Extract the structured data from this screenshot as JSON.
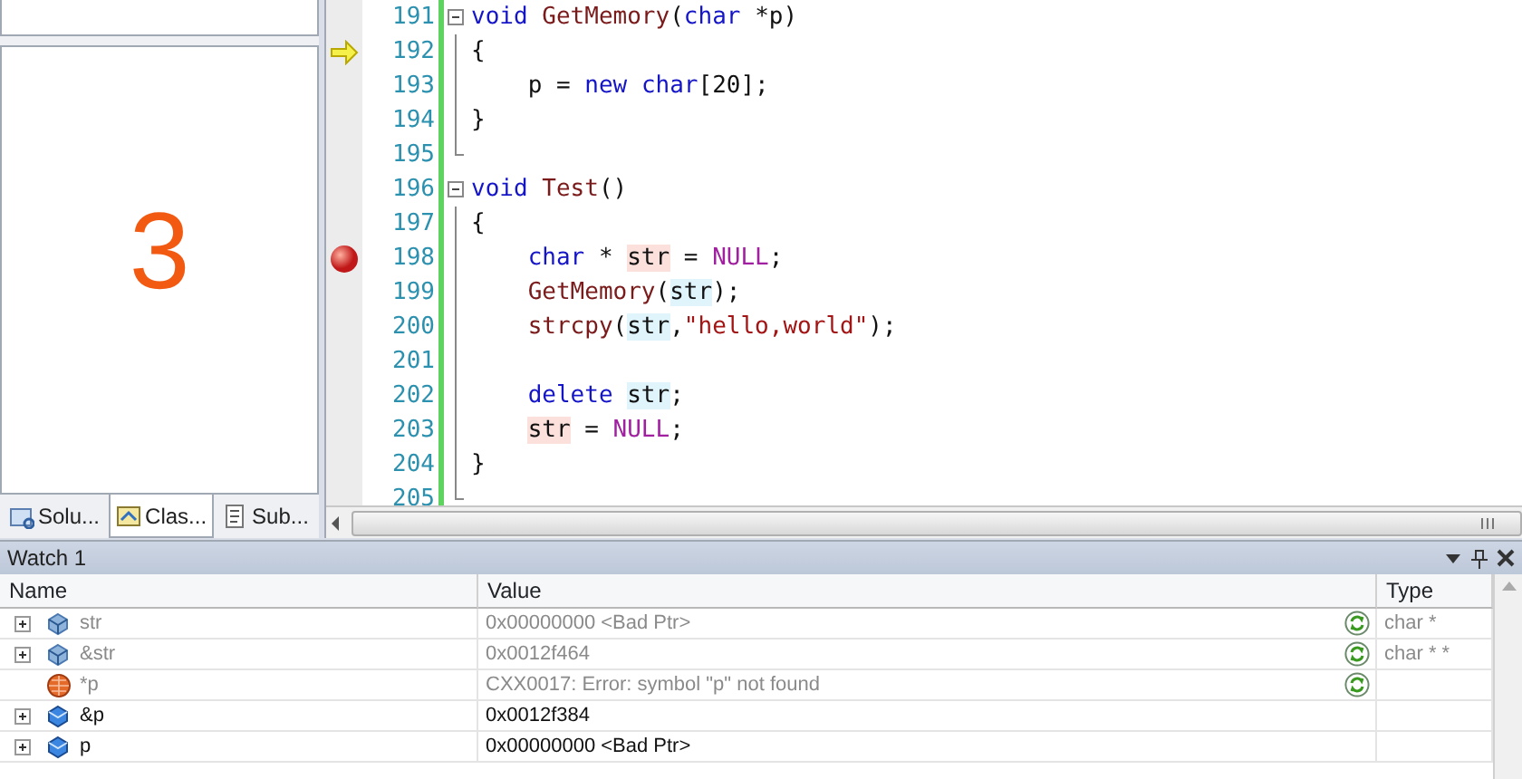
{
  "side_panel": {
    "big_label": "3",
    "tabs": [
      {
        "label": "Solu...",
        "selected": false
      },
      {
        "label": "Clas...",
        "selected": true
      },
      {
        "label": "Sub...",
        "selected": false
      }
    ]
  },
  "editor": {
    "lines": [
      {
        "number": "191",
        "fold_start": true,
        "fold_end": false,
        "current": false,
        "breakpoint": false,
        "tokens": [
          {
            "text": "void",
            "kind": "kw"
          },
          {
            "text": " GetMemory",
            "kind": "fn"
          },
          {
            "text": "(",
            "kind": "plain"
          },
          {
            "text": "char",
            "kind": "kw"
          },
          {
            "text": " *p)",
            "kind": "plain"
          }
        ]
      },
      {
        "number": "192",
        "fold_start": false,
        "fold_end": false,
        "current": true,
        "breakpoint": false,
        "tokens": [
          {
            "text": "{",
            "kind": "plain"
          }
        ]
      },
      {
        "number": "193",
        "fold_start": false,
        "fold_end": false,
        "current": false,
        "breakpoint": false,
        "tokens": [
          {
            "text": "    p = ",
            "kind": "plain"
          },
          {
            "text": "new",
            "kind": "kw"
          },
          {
            "text": " char",
            "kind": "kw"
          },
          {
            "text": "[20];",
            "kind": "plain"
          }
        ]
      },
      {
        "number": "194",
        "fold_start": false,
        "fold_end": false,
        "current": false,
        "breakpoint": false,
        "tokens": [
          {
            "text": "}",
            "kind": "plain"
          }
        ]
      },
      {
        "number": "195",
        "fold_start": false,
        "fold_end": true,
        "current": false,
        "breakpoint": false
      },
      {
        "number": "196",
        "fold_start": true,
        "fold_end": false,
        "current": false,
        "breakpoint": false,
        "tokens": [
          {
            "text": "void",
            "kind": "kw"
          },
          {
            "text": " Test",
            "kind": "fn"
          },
          {
            "text": "()",
            "kind": "plain"
          }
        ]
      },
      {
        "number": "197",
        "fold_start": false,
        "fold_end": false,
        "current": false,
        "breakpoint": false,
        "tokens": [
          {
            "text": "{",
            "kind": "plain"
          }
        ]
      },
      {
        "number": "198",
        "fold_start": false,
        "fold_end": false,
        "current": false,
        "breakpoint": true,
        "tokens": [
          {
            "text": "    char",
            "kind": "kw"
          },
          {
            "text": " * ",
            "kind": "plain"
          },
          {
            "text": "str",
            "kind": "write"
          },
          {
            "text": " = ",
            "kind": "plain"
          },
          {
            "text": "NULL",
            "kind": "macro"
          },
          {
            "text": ";",
            "kind": "plain"
          }
        ]
      },
      {
        "number": "199",
        "fold_start": false,
        "fold_end": false,
        "current": false,
        "breakpoint": false,
        "tokens": [
          {
            "text": "    GetMemory",
            "kind": "fn"
          },
          {
            "text": "(",
            "kind": "plain"
          },
          {
            "text": "str",
            "kind": "read"
          },
          {
            "text": ");",
            "kind": "plain"
          }
        ]
      },
      {
        "number": "200",
        "fold_start": false,
        "fold_end": false,
        "current": false,
        "breakpoint": false,
        "tokens": [
          {
            "text": "    strcpy",
            "kind": "fn"
          },
          {
            "text": "(",
            "kind": "plain"
          },
          {
            "text": "str",
            "kind": "read"
          },
          {
            "text": ",",
            "kind": "plain"
          },
          {
            "text": "\"hello,world\"",
            "kind": "string"
          },
          {
            "text": ");",
            "kind": "plain"
          }
        ]
      },
      {
        "number": "201",
        "fold_start": false,
        "fold_end": false,
        "current": false,
        "breakpoint": false
      },
      {
        "number": "202",
        "fold_start": false,
        "fold_end": false,
        "current": false,
        "breakpoint": false,
        "tokens": [
          {
            "text": "    delete ",
            "kind": "kw"
          },
          {
            "text": "str",
            "kind": "read"
          },
          {
            "text": ";",
            "kind": "plain"
          }
        ]
      },
      {
        "number": "203",
        "fold_start": false,
        "fold_end": false,
        "current": false,
        "breakpoint": false,
        "tokens": [
          {
            "text": "    str",
            "kind": "write"
          },
          {
            "text": " = ",
            "kind": "plain"
          },
          {
            "text": "NULL",
            "kind": "macro"
          },
          {
            "text": ";",
            "kind": "plain"
          }
        ]
      },
      {
        "number": "204",
        "fold_start": false,
        "fold_end": false,
        "current": false,
        "breakpoint": false,
        "tokens": [
          {
            "text": "}",
            "kind": "plain"
          }
        ]
      },
      {
        "number": "205",
        "fold_start": false,
        "fold_end": true,
        "current": false,
        "breakpoint": false
      }
    ]
  },
  "watch": {
    "title": "Watch 1",
    "columns": [
      "Name",
      "Value",
      "Type"
    ],
    "rows": [
      {
        "name": "str",
        "value": "0x00000000 <Bad Ptr>",
        "type": "char *",
        "kind": "field",
        "expandable": true,
        "stale": true,
        "refresh": true
      },
      {
        "name": "&str",
        "value": "0x0012f464",
        "type": "char * *",
        "kind": "field",
        "expandable": true,
        "stale": true,
        "refresh": true
      },
      {
        "name": "*p",
        "value": "CXX0017: Error: symbol \"p\" not found",
        "kind": "error",
        "expandable": false,
        "stale": true,
        "refresh": true
      },
      {
        "name": "&p",
        "value": "0x0012f384",
        "kind": "variable",
        "expandable": true,
        "stale": false,
        "refresh": false
      },
      {
        "name": "p",
        "value": "0x00000000 <Bad Ptr>",
        "kind": "variable",
        "expandable": true,
        "stale": false,
        "refresh": false
      }
    ]
  }
}
